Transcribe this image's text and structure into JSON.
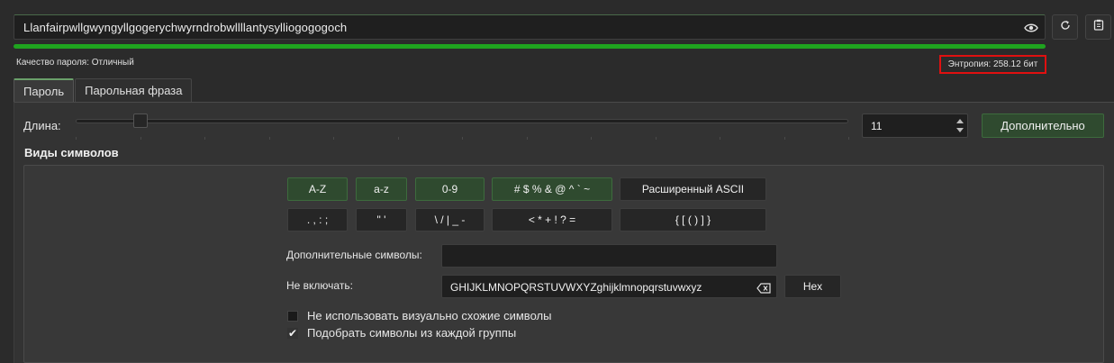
{
  "password": {
    "value": "Llanfairpwllgwyngyllgogerychwyrndrobwllllantysylliogogogoch",
    "strength_fraction": 1.0,
    "strength_color": "#1fa31f"
  },
  "icons": {
    "toggle_visibility": "eye-icon",
    "regenerate": "refresh-icon",
    "copy": "clipboard-icon",
    "clear": "backspace-clear-icon"
  },
  "quality_label": "Качество пароля: Отличный",
  "entropy_label": "Энтропия: 258.12 бит",
  "tabs": [
    {
      "label": "Пароль",
      "active": true
    },
    {
      "label": "Парольная фраза",
      "active": false
    }
  ],
  "length": {
    "label": "Длина:",
    "value": "11",
    "advanced_label": "Дополнительно"
  },
  "char_types": {
    "title": "Виды символов",
    "row1": [
      {
        "label": "A-Z",
        "on": true
      },
      {
        "label": "a-z",
        "on": true
      },
      {
        "label": "0-9",
        "on": true
      },
      {
        "label": "# $ % & @ ^ ` ~",
        "on": true
      },
      {
        "label": "Расширенный ASCII",
        "on": false
      }
    ],
    "row2": [
      {
        "label": ". , : ;",
        "on": false
      },
      {
        "label": "\" '",
        "on": false
      },
      {
        "label": "\\ / | _ -",
        "on": false
      },
      {
        "label": "< * + ! ? =",
        "on": false
      },
      {
        "label": "{ [ ( ) ] }",
        "on": false
      }
    ]
  },
  "extra_chars": {
    "label": "Дополнительные символы:",
    "value": ""
  },
  "exclude": {
    "label": "Не включать:",
    "value": "GHIJKLMNOPQRSTUVWXYZghijklmnopqrstuvwxyz",
    "hex_label": "Hex"
  },
  "options": [
    {
      "label": "Не использовать визуально схожие символы",
      "checked": false
    },
    {
      "label": "Подобрать символы из каждой группы",
      "checked": true
    }
  ],
  "colors": {
    "accent_on": "#2f4a2f",
    "highlight_border": "#e01010"
  }
}
